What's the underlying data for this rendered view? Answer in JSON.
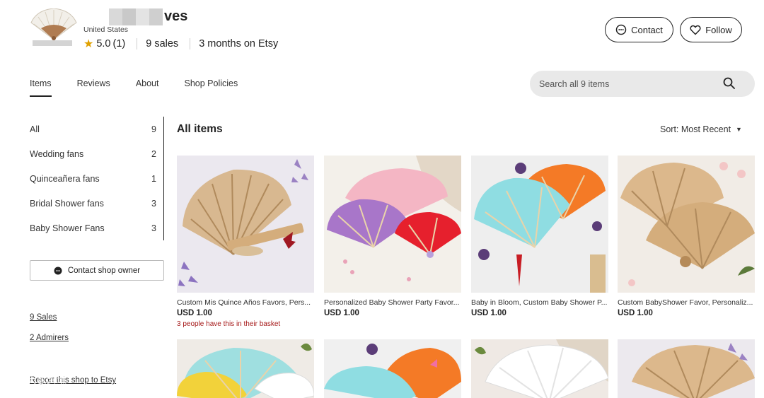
{
  "shop": {
    "name_suffix": "ves",
    "location": "United States",
    "rating": "5.0",
    "rating_count": "(1)",
    "sales_count": "9",
    "sales_label": "sales",
    "age_value": "3 months",
    "age_label": "on Etsy"
  },
  "header": {
    "contact_label": "Contact",
    "follow_label": "Follow"
  },
  "tabs": [
    {
      "label": "Items"
    },
    {
      "label": "Reviews"
    },
    {
      "label": "About"
    },
    {
      "label": "Shop Policies"
    }
  ],
  "search": {
    "placeholder": "Search all 9 items"
  },
  "sidebar": {
    "sections": [
      {
        "label": "All",
        "count": "9"
      },
      {
        "label": "Wedding fans",
        "count": "2"
      },
      {
        "label": "Quinceañera fans",
        "count": "1"
      },
      {
        "label": "Bridal Shower fans",
        "count": "3"
      },
      {
        "label": "Baby Shower Fans",
        "count": "3"
      }
    ],
    "contact_owner_label": "Contact shop owner",
    "sales_link": "9 Sales",
    "admirers_link": "2 Admirers",
    "report_link": "Report this shop to Etsy"
  },
  "main": {
    "title": "All items",
    "sort_label": "Sort: Most Recent"
  },
  "listings": [
    {
      "title": "Custom Mis Quince Años Favors, Pers...",
      "price": "USD 1.00",
      "note": "3 people have this in their basket"
    },
    {
      "title": "Personalized Baby Shower Party Favor...",
      "price": "USD 1.00"
    },
    {
      "title": "Baby in Bloom, Custom Baby Shower P...",
      "price": "USD 1.00"
    },
    {
      "title": "Custom BabyShower Favor, Personaliz...",
      "price": "USD 1.00"
    }
  ],
  "watermark": {
    "text": "大数跨境"
  },
  "colors": {
    "accent": "#222222",
    "basket_note": "#a61a1a",
    "star": "#e0a100",
    "search_bg": "#e9e9e9"
  }
}
